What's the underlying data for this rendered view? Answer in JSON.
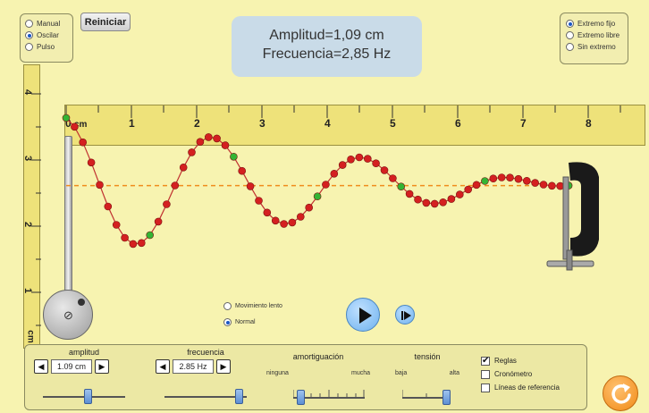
{
  "mode_options": {
    "manual": "Manual",
    "oscillate": "Oscilar",
    "pulse": "Pulso",
    "selected": "oscillate"
  },
  "reset_label": "Reiniciar",
  "info": {
    "amplitude_text": "Amplitud=1,09 cm",
    "frequency_text": "Frecuencia=2,85 Hz"
  },
  "end_options": {
    "fixed": "Extremo fijo",
    "loose": "Extremo libre",
    "none": "Sin extremo",
    "selected": "fixed"
  },
  "ruler_h": {
    "unit": "cm",
    "ticks": [
      "0",
      "1",
      "2",
      "3",
      "4",
      "5",
      "6",
      "7",
      "8"
    ]
  },
  "ruler_v": {
    "ticks": [
      "4",
      "3",
      "2",
      "1"
    ],
    "unit": "cm"
  },
  "playback": {
    "slow": "Movimiento lento",
    "normal": "Normal",
    "selected": "normal"
  },
  "controls": {
    "amplitude": {
      "label": "amplitud",
      "value": "1.09 cm",
      "fraction": 0.55
    },
    "frequency": {
      "label": "frecuencia",
      "value": "2.85 Hz",
      "fraction": 0.95
    },
    "damping": {
      "label": "amortiguación",
      "min_label": "ninguna",
      "max_label": "mucha",
      "fraction": 0.05
    },
    "tension": {
      "label": "tensión",
      "min_label": "baja",
      "max_label": "alta",
      "fraction": 1.0
    }
  },
  "checkboxes": {
    "rulers": "Reglas",
    "timer": "Cronómetro",
    "reference_lines": "Líneas de referencia",
    "rulers_checked": true
  },
  "wave": {
    "amplitude_cm": 1.09,
    "wavelength_cm": 2.3,
    "equilibrium_cm": 2.6,
    "length_cm": 7.7,
    "beads": 60
  },
  "colors": {
    "bead": "#d42020",
    "bead_marker": "#34b434",
    "string": "#c03030",
    "ruler": "#eee27a",
    "reference_line": "#f08c1c"
  }
}
